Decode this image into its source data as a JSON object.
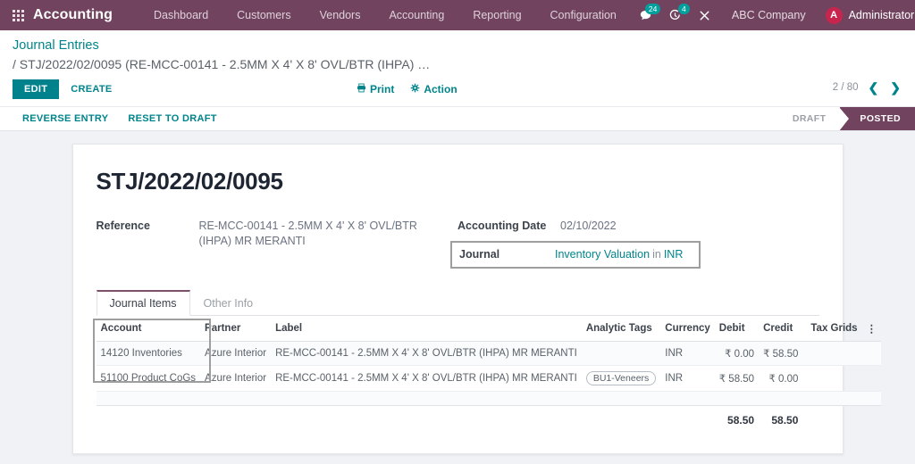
{
  "navbar": {
    "apps_icon": "apps-grid-icon",
    "brand": "Accounting",
    "menus": [
      {
        "label": "Dashboard"
      },
      {
        "label": "Customers"
      },
      {
        "label": "Vendors"
      },
      {
        "label": "Accounting"
      },
      {
        "label": "Reporting"
      },
      {
        "label": "Configuration"
      }
    ],
    "messages_badge": "24",
    "activities_badge": "4",
    "company": "ABC Company",
    "user_initial": "A",
    "user_name": "Administrator",
    "accent_color": "#71435f",
    "badge_color": "#00A09D"
  },
  "control_panel": {
    "breadcrumb_root": "Journal Entries",
    "breadcrumb_current": "/ STJ/2022/02/0095 (RE-MCC-00141 - 2.5MM X 4' X 8' OVL/BTR (IHPA) …",
    "edit_label": "EDIT",
    "create_label": "CREATE",
    "print_label": "Print",
    "action_label": "Action",
    "pager_count": "2 / 80",
    "pager_prev": "❮",
    "pager_next": "❯"
  },
  "status_bar": {
    "reverse_entry_label": "REVERSE ENTRY",
    "reset_to_draft_label": "RESET TO DRAFT",
    "states": [
      {
        "label": "DRAFT",
        "active": false
      },
      {
        "label": "POSTED",
        "active": true
      }
    ],
    "draft_label": "DRAFT",
    "posted_label": "POSTED"
  },
  "form": {
    "title": "STJ/2022/02/0095",
    "reference_label": "Reference",
    "reference_value": "RE-MCC-00141 - 2.5MM X 4' X 8' OVL/BTR (IHPA) MR MERANTI",
    "accounting_date_label": "Accounting Date",
    "accounting_date_value": "02/10/2022",
    "journal_label": "Journal",
    "journal_value": "Inventory Valuation",
    "journal_in": "in",
    "journal_currency": "INR"
  },
  "tabs": [
    {
      "label": "Journal Items",
      "active": true
    },
    {
      "label": "Other Info",
      "active": false
    }
  ],
  "table": {
    "headers": {
      "account": "Account",
      "partner": "Partner",
      "label": "Label",
      "analytic_tags": "Analytic Tags",
      "currency": "Currency",
      "debit": "Debit",
      "credit": "Credit",
      "tax_grids": "Tax Grids",
      "options": "⋮"
    },
    "rows": [
      {
        "account": "14120 Inventories",
        "partner": "Azure Interior",
        "label": "RE-MCC-00141 - 2.5MM X 4' X 8' OVL/BTR (IHPA) MR MERANTI",
        "analytic_tags": "",
        "currency": "INR",
        "debit": "₹ 0.00",
        "credit": "₹ 58.50",
        "tax_grids": ""
      },
      {
        "account": "51100 Product CoGs",
        "partner": "Azure Interior",
        "label": "RE-MCC-00141 - 2.5MM X 4' X 8' OVL/BTR (IHPA) MR MERANTI",
        "analytic_tags": "BU1-Veneers",
        "currency": "INR",
        "debit": "₹ 58.50",
        "credit": "₹ 0.00",
        "tax_grids": ""
      }
    ],
    "totals": {
      "debit": "58.50",
      "credit": "58.50"
    }
  }
}
